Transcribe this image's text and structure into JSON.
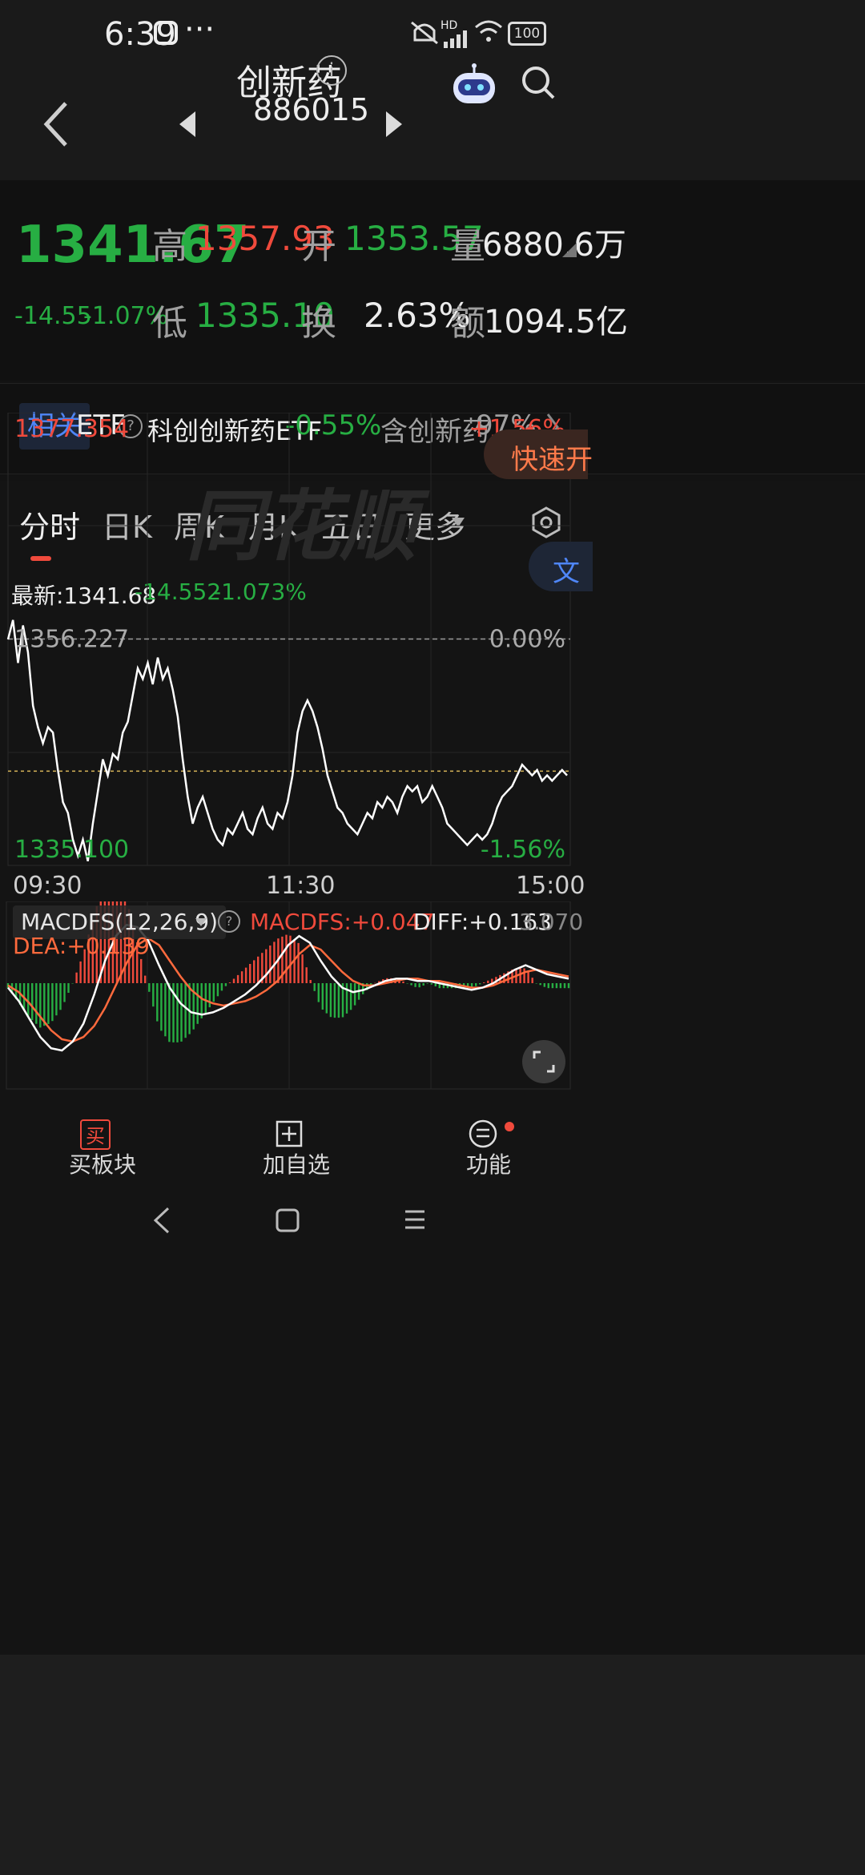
{
  "status_bar": {
    "time": "6:39",
    "battery": "100",
    "network": "HD"
  },
  "header": {
    "title": "创新药",
    "code": "886015"
  },
  "quote": {
    "price": "1341.67",
    "change": "-14.55",
    "change_pct": "-1.07%",
    "high_label": "高",
    "high": "1357.93",
    "low_label": "低",
    "low": "1335.10",
    "open_label": "开",
    "open": "1353.57",
    "turnover_label": "换",
    "turnover": "2.63%",
    "volume_label": "量",
    "volume": "6880.6万",
    "amount_label": "额",
    "amount": "1094.5亿"
  },
  "related": {
    "tag": "相关",
    "etf_label": "ETF",
    "etf_name": "科创创新药ETF",
    "etf_change": "-0.55%",
    "contains_label": "含创新药",
    "contains_pct": "97%"
  },
  "tabs": {
    "items": [
      "分时",
      "日K",
      "周K",
      "月K",
      "五日",
      "更多"
    ]
  },
  "chart_info": {
    "latest": "最新:1341.68",
    "change": "-14.552",
    "change_pct": "-1.073%",
    "quick_open": "快速开",
    "side_tab": "文",
    "watermark": "同花顺"
  },
  "macd": {
    "label": "MACDFS(12,26,9)",
    "macdfs": "MACDFS:+0.047",
    "diff": "DIFF:+0.163",
    "dea": "DEA:+0.139",
    "axis_max": "3.070"
  },
  "bottom_tabs": {
    "buy_icon": "买",
    "buy": "买板块",
    "add": "加自选",
    "func": "功能"
  },
  "chart_data": {
    "type": "line",
    "y_ticks_left": [
      "1377.354",
      "1356.227",
      "1335.100"
    ],
    "y_ticks_right": [
      "+1.56%",
      "0.00%",
      "-1.56%"
    ],
    "x_ticks": [
      "09:30",
      "11:30",
      "15:00"
    ],
    "ylim": [
      1335.1,
      1377.354
    ],
    "reference": 1356.227,
    "average_line": 1343.9,
    "series": [
      {
        "values": [
          1356.2,
          1358.0,
          1354.0,
          1357.5,
          1355.0,
          1350.0,
          1348.0,
          1346.5,
          1348.0,
          1347.5,
          1344.0,
          1341.0,
          1340.0,
          1337.5,
          1336.0,
          1337.5,
          1335.5,
          1339.0,
          1342.0,
          1345.0,
          1343.5,
          1345.5,
          1345.0,
          1347.5,
          1348.5,
          1351.0,
          1353.5,
          1352.5,
          1354.0,
          1352.0,
          1354.5,
          1352.5,
          1353.5,
          1351.5,
          1349.0,
          1345.0,
          1341.5,
          1339.0,
          1340.5,
          1341.5,
          1340.0,
          1338.5,
          1337.5,
          1337.0,
          1338.5,
          1338.0,
          1339.0,
          1340.0,
          1338.5,
          1338.0,
          1339.5,
          1340.5,
          1339.0,
          1338.5,
          1340.0,
          1339.5,
          1341.0,
          1343.5,
          1347.5,
          1349.5,
          1350.5,
          1349.5,
          1348.0,
          1346.0,
          1343.5,
          1342.0,
          1340.5,
          1340.0,
          1339.0,
          1338.5,
          1338.0,
          1339.0,
          1340.0,
          1339.5,
          1341.0,
          1340.5,
          1341.5,
          1341.0,
          1340.0,
          1341.5,
          1342.5,
          1342.0,
          1342.5,
          1341.0,
          1341.5,
          1342.5,
          1341.5,
          1340.5,
          1339.0,
          1338.5,
          1338.0,
          1337.5,
          1337.0,
          1337.5,
          1338.0,
          1337.5,
          1338.0,
          1339.0,
          1340.5,
          1341.5,
          1342.0,
          1342.5,
          1343.5,
          1344.5,
          1344.0,
          1343.5,
          1344.0,
          1343.0,
          1343.5,
          1343.0,
          1343.5,
          1344.0,
          1343.5
        ]
      }
    ],
    "macd": {
      "diff": [
        -0.2,
        -0.8,
        -1.6,
        -2.4,
        -2.9,
        -3.0,
        -2.6,
        -1.8,
        -0.5,
        1.0,
        2.1,
        2.6,
        2.5,
        1.9,
        0.8,
        -0.2,
        -0.9,
        -1.3,
        -1.4,
        -1.3,
        -1.1,
        -0.8,
        -0.5,
        -0.1,
        0.4,
        1.0,
        1.7,
        2.1,
        1.8,
        1.0,
        0.3,
        -0.2,
        -0.4,
        -0.3,
        -0.1,
        0.1,
        0.2,
        0.2,
        0.1,
        0.1,
        0.0,
        -0.1,
        -0.2,
        -0.3,
        -0.2,
        0.0,
        0.3,
        0.6,
        0.8,
        0.6,
        0.4,
        0.3,
        0.2
      ],
      "dea": [
        -0.1,
        -0.4,
        -0.9,
        -1.5,
        -2.1,
        -2.5,
        -2.6,
        -2.4,
        -1.9,
        -1.1,
        -0.1,
        0.9,
        1.7,
        2.0,
        1.7,
        1.0,
        0.3,
        -0.3,
        -0.7,
        -0.9,
        -1.0,
        -0.9,
        -0.8,
        -0.6,
        -0.3,
        0.1,
        0.7,
        1.3,
        1.7,
        1.5,
        1.0,
        0.5,
        0.1,
        -0.1,
        -0.1,
        0.0,
        0.1,
        0.2,
        0.2,
        0.1,
        0.1,
        0.0,
        -0.1,
        -0.2,
        -0.2,
        -0.1,
        0.1,
        0.3,
        0.5,
        0.6,
        0.5,
        0.4,
        0.3
      ]
    }
  },
  "colors": {
    "up": "#f04a3c",
    "down": "#27ae43",
    "price_line": "#ffffff",
    "dea_line": "#ff6a3d",
    "avg_line": "#d9b65a"
  }
}
